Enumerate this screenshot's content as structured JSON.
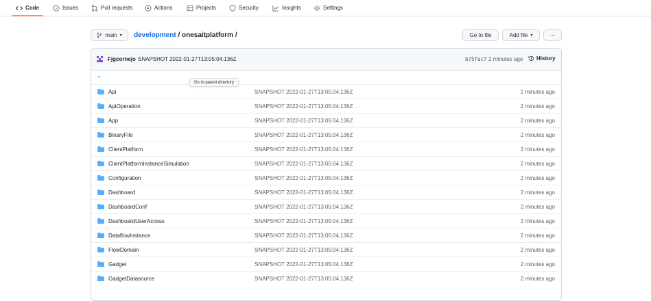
{
  "tabs": [
    {
      "label": "Code",
      "icon": "code-icon",
      "active": true
    },
    {
      "label": "Issues",
      "icon": "issue-opened-icon",
      "active": false
    },
    {
      "label": "Pull requests",
      "icon": "git-pull-request-icon",
      "active": false
    },
    {
      "label": "Actions",
      "icon": "play-icon",
      "active": false
    },
    {
      "label": "Projects",
      "icon": "table-icon",
      "active": false
    },
    {
      "label": "Security",
      "icon": "shield-icon",
      "active": false
    },
    {
      "label": "Insights",
      "icon": "graph-icon",
      "active": false
    },
    {
      "label": "Settings",
      "icon": "gear-icon",
      "active": false
    }
  ],
  "branch": {
    "label": "main",
    "icon": "git-branch-icon"
  },
  "breadcrumb": {
    "repo": "development",
    "separator": "/",
    "folder": "onesaitplatform",
    "trailing": "/"
  },
  "actions": {
    "go_to_file": "Go to file",
    "add_file": "Add file",
    "more": "···"
  },
  "commit": {
    "author": "Fjgcornejo",
    "message": "SNAPSHOT 2022-01-27T13:05:04.136Z",
    "sha": "b75fac7",
    "time": "2 minutes ago",
    "history_label": "History"
  },
  "parent": {
    "label": "..",
    "tooltip": "Go to parent directory"
  },
  "files": [
    {
      "name": "Api",
      "message": "SNAPSHOT 2022-01-27T13:05:04.136Z",
      "age": "2 minutes ago"
    },
    {
      "name": "ApiOperation",
      "message": "SNAPSHOT 2022-01-27T13:05:04.136Z",
      "age": "2 minutes ago"
    },
    {
      "name": "App",
      "message": "SNAPSHOT 2022-01-27T13:05:04.136Z",
      "age": "2 minutes ago"
    },
    {
      "name": "BinaryFile",
      "message": "SNAPSHOT 2022-01-27T13:05:04.136Z",
      "age": "2 minutes ago"
    },
    {
      "name": "ClientPlatform",
      "message": "SNAPSHOT 2022-01-27T13:05:04.136Z",
      "age": "2 minutes ago"
    },
    {
      "name": "ClientPlatformInstanceSimulation",
      "message": "SNAPSHOT 2022-01-27T13:05:04.136Z",
      "age": "2 minutes ago"
    },
    {
      "name": "Configuration",
      "message": "SNAPSHOT 2022-01-27T13:05:04.136Z",
      "age": "2 minutes ago"
    },
    {
      "name": "Dashboard",
      "message": "SNAPSHOT 2022-01-27T13:05:04.136Z",
      "age": "2 minutes ago"
    },
    {
      "name": "DashboardConf",
      "message": "SNAPSHOT 2022-01-27T13:05:04.136Z",
      "age": "2 minutes ago"
    },
    {
      "name": "DashboardUserAccess",
      "message": "SNAPSHOT 2022-01-27T13:05:04.136Z",
      "age": "2 minutes ago"
    },
    {
      "name": "DataflowInstance",
      "message": "SNAPSHOT 2022-01-27T13:05:04.136Z",
      "age": "2 minutes ago"
    },
    {
      "name": "FlowDomain",
      "message": "SNAPSHOT 2022-01-27T13:05:04.136Z",
      "age": "2 minutes ago"
    },
    {
      "name": "Gadget",
      "message": "SNAPSHOT 2022-01-27T13:05:04.136Z",
      "age": "2 minutes ago"
    },
    {
      "name": "GadgetDatasource",
      "message": "SNAPSHOT 2022-01-27T13:05:04.136Z",
      "age": "2 minutes ago"
    }
  ],
  "colors": {
    "link": "#0969da",
    "folder": "#54aeff",
    "active_tab_underline": "#fd8c73",
    "avatar": "#8250df"
  }
}
